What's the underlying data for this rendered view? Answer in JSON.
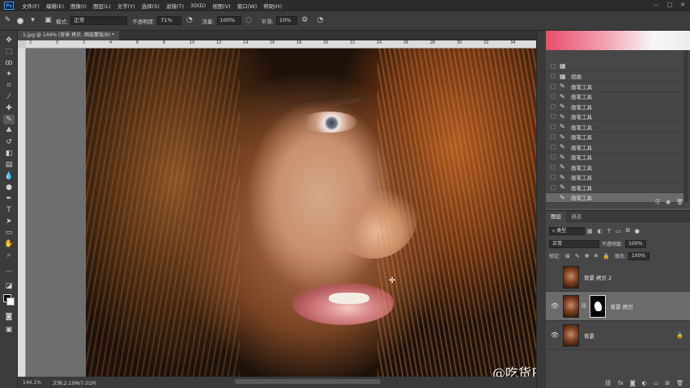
{
  "menubar": {
    "items": [
      "文件(F)",
      "编辑(E)",
      "图像(I)",
      "图层(L)",
      "文字(Y)",
      "选择(S)",
      "滤镜(T)",
      "3D(D)",
      "视图(V)",
      "窗口(W)",
      "帮助(H)"
    ],
    "window_controls": [
      "—",
      "□",
      "✕"
    ]
  },
  "options": {
    "mode_label": "模式:",
    "mode_value": "正常",
    "opacity_label": "不透明度:",
    "opacity_value": "71%",
    "flow_label": "流量:",
    "flow_value": "100%",
    "smooth_label": "平滑:",
    "smooth_value": "10%"
  },
  "document": {
    "tab_title": "1.jpg @ 144% (背景 拷贝, 图层蒙版/8) *",
    "zoom": "144.1%",
    "doc_info": "文档:2.10M/7.01M",
    "ruler_ticks": [
      "2",
      "0",
      "2",
      "4",
      "6",
      "8",
      "10",
      "12",
      "14",
      "16",
      "18",
      "20",
      "22",
      "24",
      "26",
      "28",
      "30",
      "32",
      "34"
    ]
  },
  "watermark": "@吃货PS教程",
  "history": {
    "items": [
      {
        "label": "",
        "icon": "image-icon"
      },
      {
        "label": "扭曲",
        "icon": "image-icon"
      },
      {
        "label": "画笔工具",
        "icon": "brush-icon"
      },
      {
        "label": "画笔工具",
        "icon": "brush-icon"
      },
      {
        "label": "画笔工具",
        "icon": "brush-icon"
      },
      {
        "label": "画笔工具",
        "icon": "brush-icon"
      },
      {
        "label": "画笔工具",
        "icon": "brush-icon"
      },
      {
        "label": "画笔工具",
        "icon": "brush-icon"
      },
      {
        "label": "画笔工具",
        "icon": "brush-icon"
      },
      {
        "label": "画笔工具",
        "icon": "brush-icon"
      },
      {
        "label": "画笔工具",
        "icon": "brush-icon"
      },
      {
        "label": "画笔工具",
        "icon": "brush-icon"
      },
      {
        "label": "画笔工具",
        "icon": "brush-icon"
      },
      {
        "label": "画笔工具",
        "icon": "brush-icon"
      }
    ],
    "selected_index": 13
  },
  "layers": {
    "tabs": [
      "图层",
      "通道"
    ],
    "filter_label": "类型",
    "blend_mode": "正常",
    "opacity_label": "不透明度:",
    "opacity_value": "100%",
    "lock_label": "锁定:",
    "fill_label": "填充:",
    "fill_value": "100%",
    "items": [
      {
        "name": "背景 拷贝 2",
        "visible": false,
        "has_mask": false,
        "locked": false
      },
      {
        "name": "背景 拷贝",
        "visible": true,
        "has_mask": true,
        "locked": false
      },
      {
        "name": "背景",
        "visible": true,
        "has_mask": false,
        "locked": true
      }
    ],
    "selected_index": 1
  },
  "colors": {
    "foreground": "#000000",
    "background": "#ffffff"
  }
}
